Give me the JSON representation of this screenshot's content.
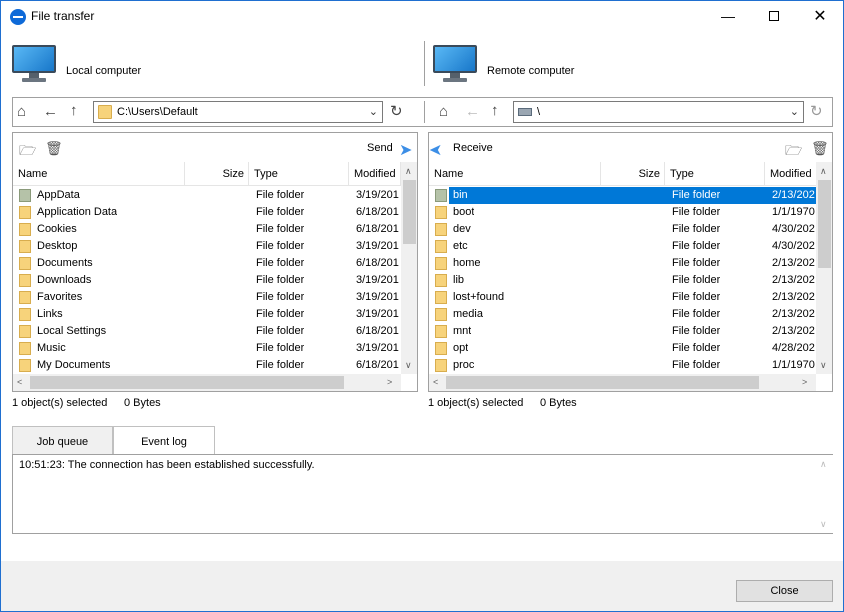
{
  "window": {
    "title": "File transfer",
    "minimize_icon": "minimize-icon",
    "maximize_icon": "maximize-icon",
    "close_icon": "close-icon"
  },
  "local": {
    "header_label": "Local computer",
    "path": "C:\\Users\\Default",
    "action_label": "Send",
    "columns": [
      "Name",
      "Size",
      "Type",
      "Modified"
    ],
    "rows": [
      {
        "name": "AppData",
        "type": "File folder",
        "modified": "3/19/201",
        "icon": "hidden"
      },
      {
        "name": "Application Data",
        "type": "File folder",
        "modified": "6/18/201"
      },
      {
        "name": "Cookies",
        "type": "File folder",
        "modified": "6/18/201"
      },
      {
        "name": "Desktop",
        "type": "File folder",
        "modified": "3/19/201"
      },
      {
        "name": "Documents",
        "type": "File folder",
        "modified": "6/18/201"
      },
      {
        "name": "Downloads",
        "type": "File folder",
        "modified": "3/19/201"
      },
      {
        "name": "Favorites",
        "type": "File folder",
        "modified": "3/19/201"
      },
      {
        "name": "Links",
        "type": "File folder",
        "modified": "3/19/201"
      },
      {
        "name": "Local Settings",
        "type": "File folder",
        "modified": "6/18/201"
      },
      {
        "name": "Music",
        "type": "File folder",
        "modified": "3/19/201"
      },
      {
        "name": "My Documents",
        "type": "File folder",
        "modified": "6/18/201"
      }
    ],
    "status_selected": "1 object(s) selected",
    "status_size": "0 Bytes"
  },
  "remote": {
    "header_label": "Remote computer",
    "path": "\\",
    "action_label": "Receive",
    "columns": [
      "Name",
      "Size",
      "Type",
      "Modified"
    ],
    "rows": [
      {
        "name": "bin",
        "type": "File folder",
        "modified": "2/13/202",
        "selected": true
      },
      {
        "name": "boot",
        "type": "File folder",
        "modified": "1/1/1970"
      },
      {
        "name": "dev",
        "type": "File folder",
        "modified": "4/30/202"
      },
      {
        "name": "etc",
        "type": "File folder",
        "modified": "4/30/202"
      },
      {
        "name": "home",
        "type": "File folder",
        "modified": "2/13/202"
      },
      {
        "name": "lib",
        "type": "File folder",
        "modified": "2/13/202"
      },
      {
        "name": "lost+found",
        "type": "File folder",
        "modified": "2/13/202"
      },
      {
        "name": "media",
        "type": "File folder",
        "modified": "2/13/202"
      },
      {
        "name": "mnt",
        "type": "File folder",
        "modified": "2/13/202"
      },
      {
        "name": "opt",
        "type": "File folder",
        "modified": "4/28/202"
      },
      {
        "name": "proc",
        "type": "File folder",
        "modified": "1/1/1970"
      }
    ],
    "status_selected": "1 object(s) selected",
    "status_size": "0 Bytes"
  },
  "tabs": [
    {
      "label": "Job queue"
    },
    {
      "label": "Event log",
      "active": true
    }
  ],
  "log": {
    "entries": [
      "10:51:23: The connection has been established successfully."
    ]
  },
  "footer": {
    "close_label": "Close"
  },
  "colors": {
    "accent": "#0078d7",
    "send_arrow": "#3c8ee6",
    "folder": "#f7d37b"
  }
}
